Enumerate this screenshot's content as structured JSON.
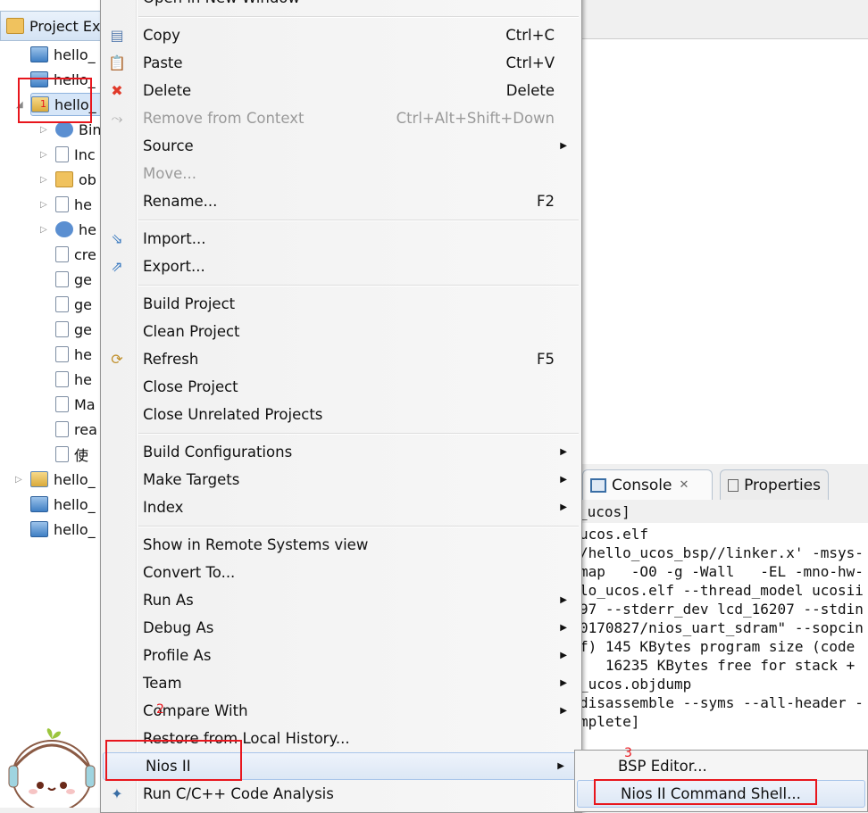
{
  "explorer": {
    "title": "Project Ex",
    "items": [
      {
        "label": "hello_",
        "icon": "project-folder-icon",
        "level": 0
      },
      {
        "label": "hello_",
        "icon": "project-folder-icon",
        "level": 0
      },
      {
        "label": "hello_",
        "icon": "c-project-open-icon",
        "level": 0,
        "expanded": true,
        "selected": true
      },
      {
        "label": "Bin",
        "icon": "binaries-icon",
        "level": 1,
        "twisty": true
      },
      {
        "label": "Inc",
        "icon": "includes-icon",
        "level": 1,
        "twisty": true
      },
      {
        "label": "ob",
        "icon": "folder-icon",
        "level": 1,
        "twisty": true
      },
      {
        "label": "he",
        "icon": "c-source-icon",
        "level": 1,
        "twisty": true
      },
      {
        "label": "he",
        "icon": "bug-icon",
        "level": 1,
        "twisty": true
      },
      {
        "label": "cre",
        "icon": "file-icon",
        "level": 1
      },
      {
        "label": "ge",
        "icon": "file-icon",
        "level": 1
      },
      {
        "label": "ge",
        "icon": "file-icon",
        "level": 1
      },
      {
        "label": "ge",
        "icon": "image-file-icon",
        "level": 1
      },
      {
        "label": "he",
        "icon": "file-icon",
        "level": 1
      },
      {
        "label": "he",
        "icon": "file-icon",
        "level": 1
      },
      {
        "label": "Ma",
        "icon": "makefile-icon",
        "level": 1
      },
      {
        "label": "rea",
        "icon": "file-icon",
        "level": 1
      },
      {
        "label": "使",
        "icon": "file-icon",
        "level": 1
      },
      {
        "label": "hello_",
        "icon": "c-project-icon",
        "level": 0,
        "twisty": true
      },
      {
        "label": "hello_",
        "icon": "project-folder-icon",
        "level": 0
      },
      {
        "label": "hello_",
        "icon": "project-folder-icon",
        "level": 0
      }
    ]
  },
  "context_menu": {
    "items": [
      {
        "label": "Open in New Window"
      },
      {
        "sep": true
      },
      {
        "label": "Copy",
        "shortcut": "Ctrl+C",
        "icon": "copy-icon"
      },
      {
        "label": "Paste",
        "shortcut": "Ctrl+V",
        "icon": "paste-icon"
      },
      {
        "label": "Delete",
        "shortcut": "Delete",
        "icon": "delete-icon"
      },
      {
        "label": "Remove from Context",
        "shortcut": "Ctrl+Alt+Shift+Down",
        "icon": "remove-context-icon",
        "disabled": true
      },
      {
        "label": "Source",
        "submenu": true
      },
      {
        "label": "Move...",
        "disabled": true
      },
      {
        "label": "Rename...",
        "shortcut": "F2"
      },
      {
        "sep": true
      },
      {
        "label": "Import...",
        "icon": "import-icon"
      },
      {
        "label": "Export...",
        "icon": "export-icon"
      },
      {
        "sep": true
      },
      {
        "label": "Build Project"
      },
      {
        "label": "Clean Project"
      },
      {
        "label": "Refresh",
        "shortcut": "F5",
        "icon": "refresh-icon"
      },
      {
        "label": "Close Project"
      },
      {
        "label": "Close Unrelated Projects"
      },
      {
        "sep": true
      },
      {
        "label": "Build Configurations",
        "submenu": true
      },
      {
        "label": "Make Targets",
        "submenu": true
      },
      {
        "label": "Index",
        "submenu": true
      },
      {
        "sep": true
      },
      {
        "label": "Show in Remote Systems view"
      },
      {
        "label": "Convert To..."
      },
      {
        "label": "Run As",
        "submenu": true
      },
      {
        "label": "Debug As",
        "submenu": true
      },
      {
        "label": "Profile As",
        "submenu": true
      },
      {
        "label": "Team",
        "submenu": true
      },
      {
        "label": "Compare With",
        "submenu": true
      },
      {
        "label": "Restore from Local History..."
      },
      {
        "label": "Nios II",
        "submenu": true,
        "highlighted": true
      },
      {
        "label": "Run C/C++ Code Analysis",
        "icon": "code-analysis-icon"
      }
    ]
  },
  "submenu": {
    "items": [
      {
        "label": "BSP Editor..."
      },
      {
        "label": "Nios II Command Shell...",
        "highlighted": true
      }
    ]
  },
  "console": {
    "tabs": [
      {
        "label": "Console",
        "active": true,
        "close": "✕"
      },
      {
        "label": "Properties"
      }
    ],
    "title": "_ucos]",
    "lines": [
      "ucos.elf",
      "/hello_ucos_bsp//linker.x' -msys-",
      "map   -O0 -g -Wall   -EL -mno-hw-",
      "lo_ucos.elf --thread_model ucosii",
      "97 --stderr_dev lcd_16207 --stdin",
      "0170827/nios_uart_sdram\" --sopcin",
      "f) 145 KBytes program size (code",
      "   16235 KBytes free for stack +",
      "_ucos.objdump",
      "disassemble --syms --all-header -",
      "mplete]"
    ]
  },
  "annotations": [
    "1",
    "2",
    "3"
  ],
  "colors": {
    "annotation": "#e8161d",
    "highlight": "#dce7f5"
  }
}
